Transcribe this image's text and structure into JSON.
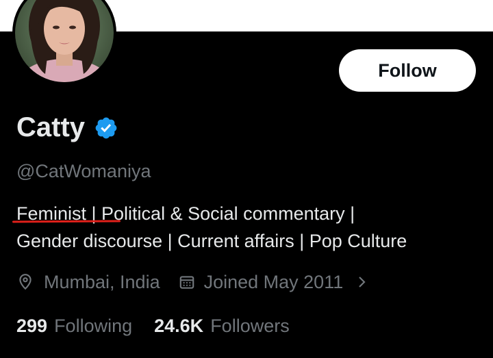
{
  "profile": {
    "display_name": "Catty",
    "handle": "@CatWomaniya",
    "bio_line_1": "Feminist | Political & Social commentary |",
    "bio_line_2": "Gender discourse | Current affairs | Pop Culture",
    "location": "Mumbai, India",
    "joined": "Joined May 2011",
    "following_count": "299",
    "following_label": "Following",
    "followers_count": "24.6K",
    "followers_label": "Followers"
  },
  "actions": {
    "follow_label": "Follow"
  },
  "icons": {
    "verified": "verified-badge-icon",
    "location": "location-pin-icon",
    "calendar": "calendar-icon",
    "more": "chevron-right-icon"
  },
  "colors": {
    "background": "#000000",
    "verified_blue": "#1d9bf0",
    "annotation_underline": "#e0201a",
    "secondary_text": "#71767b"
  }
}
